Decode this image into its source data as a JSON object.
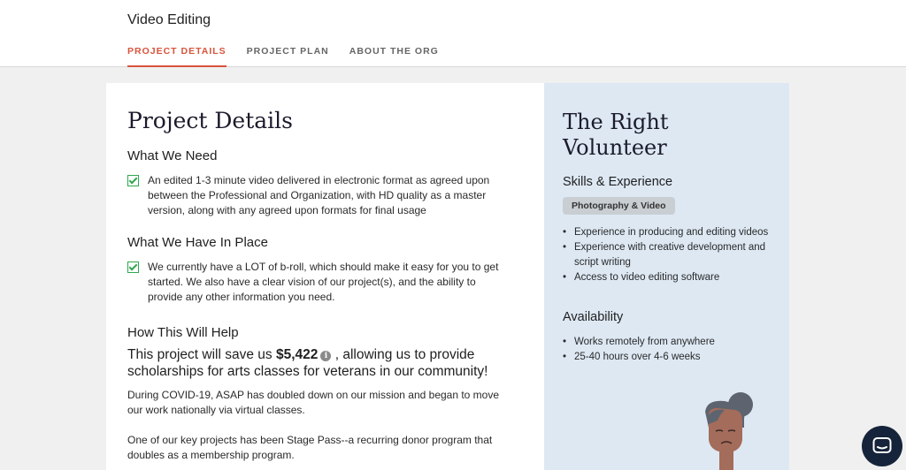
{
  "header": {
    "title": "Video Editing",
    "tabs": [
      {
        "label": "PROJECT DETAILS",
        "active": true
      },
      {
        "label": "PROJECT PLAN",
        "active": false
      },
      {
        "label": "ABOUT THE ORG",
        "active": false
      }
    ]
  },
  "details": {
    "title": "Project Details",
    "what_we_need": {
      "heading": "What We Need",
      "text": "An edited 1-3 minute video delivered in electronic format as agreed upon between the Professional and Organization, with HD quality as a master version, along with any agreed upon formats for final usage"
    },
    "in_place": {
      "heading": "What We Have In Place",
      "text": "We currently have a LOT of b-roll, which should make it easy for you to get started. We also have a clear vision of our project(s), and the ability to provide any other information you need."
    },
    "help": {
      "heading": "How This Will Help",
      "impact_prefix": "This project will save us ",
      "impact_amount": "$5,422",
      "impact_suffix": " , allowing us to provide scholarships for arts classes for veterans in our community!",
      "para1": "During COVID-19, ASAP has doubled down on our mission and began to move our work nationally via virtual classes.",
      "para2": "One of our key projects has been Stage Pass--a recurring donor program that doubles as a membership program."
    }
  },
  "volunteer": {
    "title": "The Right Volunteer",
    "skills_heading": "Skills & Experience",
    "skill_chip": "Photography & Video",
    "skills": [
      "Experience in producing and editing videos",
      "Experience with creative development and script writing",
      "Access to video editing software"
    ],
    "availability_heading": "Availability",
    "availability": [
      "Works remotely from anywhere",
      "25-40 hours over 4-6 weeks"
    ]
  },
  "colors": {
    "accent": "#d9533b",
    "check": "#2fa84f",
    "panel_bg": "#dde8f3",
    "chat_bg": "#15243a"
  },
  "icons": {
    "info": "info-icon",
    "checkbox": "checkbox-checked-icon",
    "chat": "chat-icon"
  }
}
